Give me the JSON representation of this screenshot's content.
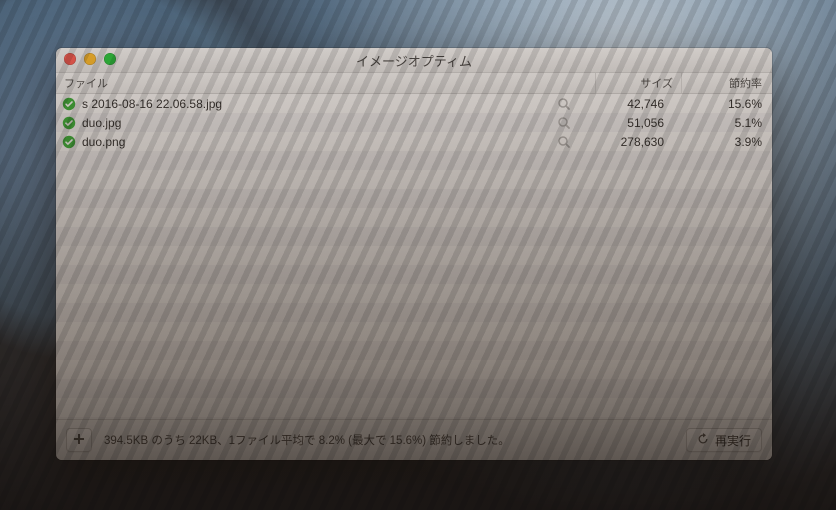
{
  "window": {
    "title": "イメージオプティム"
  },
  "columns": {
    "file": "ファイル",
    "size": "サイズ",
    "savings": "節約率"
  },
  "rows": [
    {
      "status": "ok",
      "filename": "s 2016-08-16 22.06.58.jpg",
      "size": "42,746",
      "savings": "15.6%"
    },
    {
      "status": "ok",
      "filename": "duo.jpg",
      "size": "51,056",
      "savings": "5.1%"
    },
    {
      "status": "ok",
      "filename": "duo.png",
      "size": "278,630",
      "savings": "3.9%"
    }
  ],
  "footer": {
    "status_text": "394.5KB のうち 22KB、1ファイル平均で 8.2% (最大で 15.6%) 節約しました。",
    "rerun_label": "再実行"
  }
}
